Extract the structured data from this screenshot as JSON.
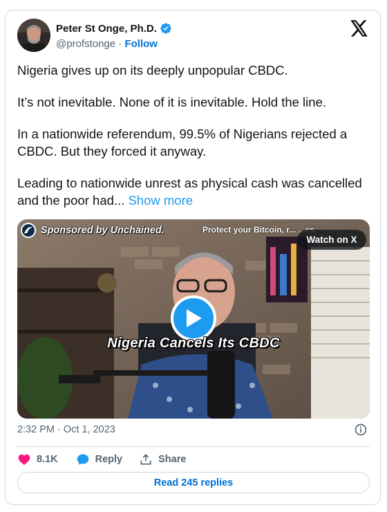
{
  "author": {
    "name": "Peter St Onge, Ph.D.",
    "handle": "@profstonge",
    "separator": "·",
    "follow_label": "Follow"
  },
  "tweet": {
    "paragraphs": [
      "Nigeria gives up on its deeply unpopular CBDC.",
      "It’s not inevitable. None of it is inevitable. Hold the line.",
      "In a nationwide referendum, 99.5% of Nigerians rejected a CBDC. But they forced it anyway."
    ],
    "last_paragraph": "Leading to nationwide unrest as physical cash was cancelled and the poor had...",
    "show_more_label": "Show more"
  },
  "media": {
    "sponsor_text": "Sponsored by Unchained.",
    "sponsor_sub": "Protect your Bitcoin, r... ...es",
    "watch_label": "Watch on X",
    "caption": "Nigeria Cancels Its CBDC"
  },
  "meta": {
    "timestamp": "2:32 PM · Oct 1, 2023"
  },
  "actions": {
    "like_count": "8.1K",
    "reply_label": "Reply",
    "share_label": "Share"
  },
  "read_replies_label": "Read 245 replies",
  "icons": {
    "verified": "verified-badge-icon",
    "x_logo": "x-logo-icon",
    "info": "info-icon",
    "like": "heart-icon",
    "reply": "speech-bubble-icon",
    "share": "share-upload-icon",
    "play": "play-icon"
  },
  "colors": {
    "accent": "#1d9bf0",
    "link": "#006fd6",
    "like": "#f91880",
    "muted": "#536471"
  }
}
